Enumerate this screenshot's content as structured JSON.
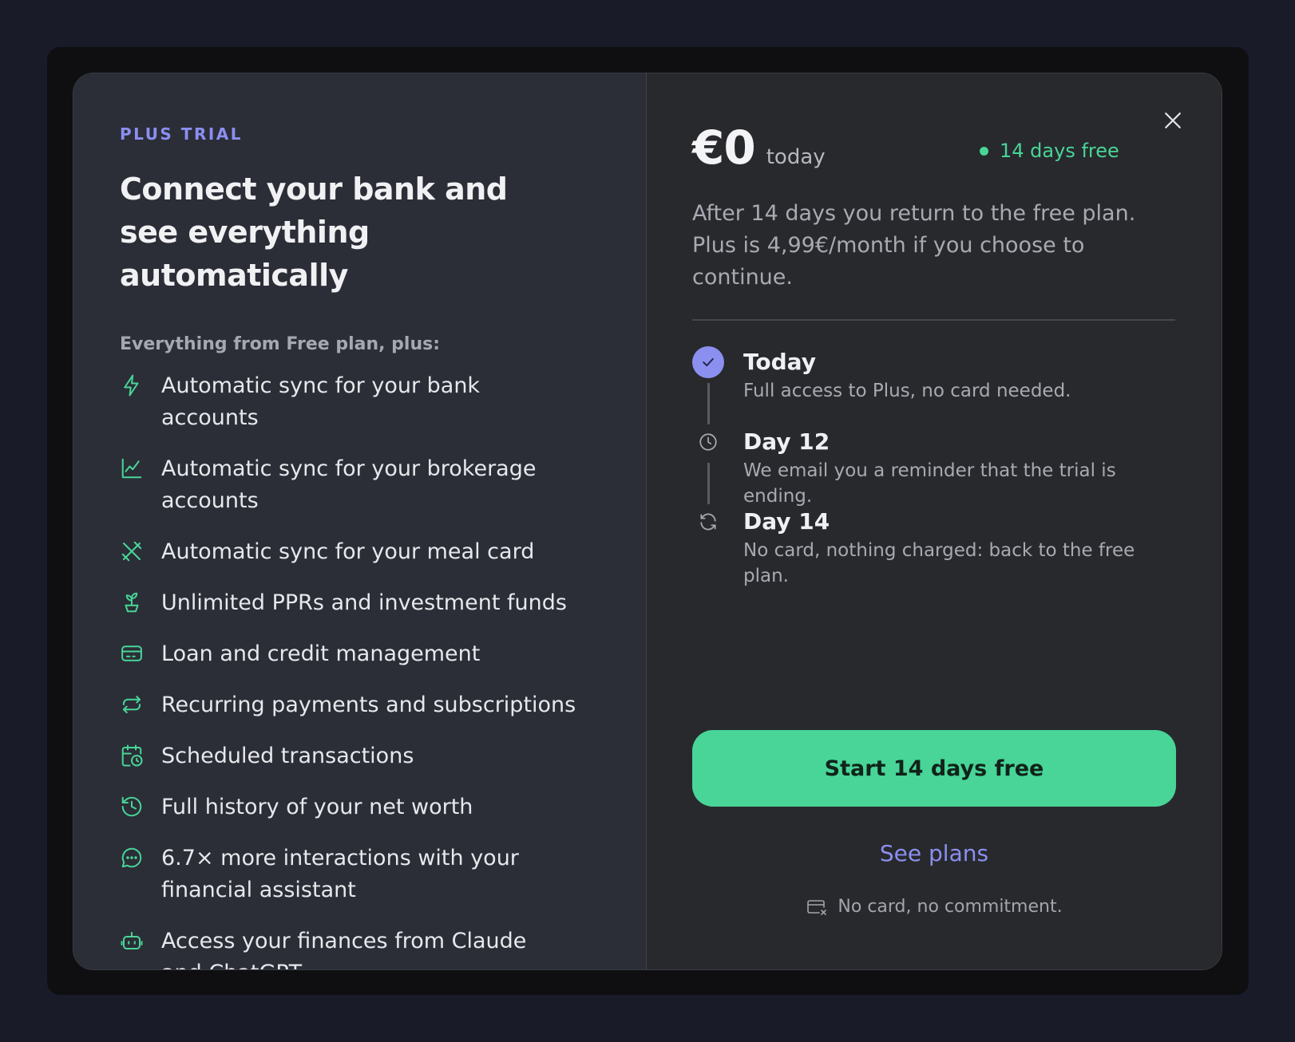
{
  "left": {
    "eyebrow": "PLUS TRIAL",
    "headline": "Connect your bank and see everything automatically",
    "sublabel": "Everything from Free plan, plus:",
    "features": [
      {
        "icon": "lightning-icon",
        "text": "Automatic sync for your bank accounts"
      },
      {
        "icon": "chart-line-icon",
        "text": "Automatic sync for your brokerage accounts"
      },
      {
        "icon": "utensils-icon",
        "text": "Automatic sync for your meal card"
      },
      {
        "icon": "plant-icon",
        "text": "Unlimited PPRs and investment funds"
      },
      {
        "icon": "credit-card-icon",
        "text": "Loan and credit management"
      },
      {
        "icon": "repeat-icon",
        "text": "Recurring payments and subscriptions"
      },
      {
        "icon": "calendar-clock-icon",
        "text": "Scheduled transactions"
      },
      {
        "icon": "history-icon",
        "text": "Full history of your net worth"
      },
      {
        "icon": "chat-bubble-icon",
        "text": "6.7× more interactions with your financial assistant"
      },
      {
        "icon": "bot-icon",
        "text": "Access your finances from Claude and ChatGPT"
      }
    ]
  },
  "right": {
    "price": "€0",
    "price_suffix": "today",
    "badge": "14 days free",
    "description": "After 14 days you return to the free plan. Plus is 4,99€/month if you choose to continue.",
    "timeline": [
      {
        "title": "Today",
        "subtitle": "Full access to Plus, no card needed."
      },
      {
        "title": "Day 12",
        "subtitle": "We email you a reminder that the trial is ending."
      },
      {
        "title": "Day 14",
        "subtitle": "No card, nothing charged: back to the free plan."
      }
    ],
    "cta_label": "Start 14 days free",
    "secondary_link": "See plans",
    "note": "No card, no commitment."
  },
  "colors": {
    "accent_green": "#48d597",
    "accent_purple": "#8b8ff0",
    "left_panel": "#2b2e37",
    "right_panel": "#28292d"
  }
}
